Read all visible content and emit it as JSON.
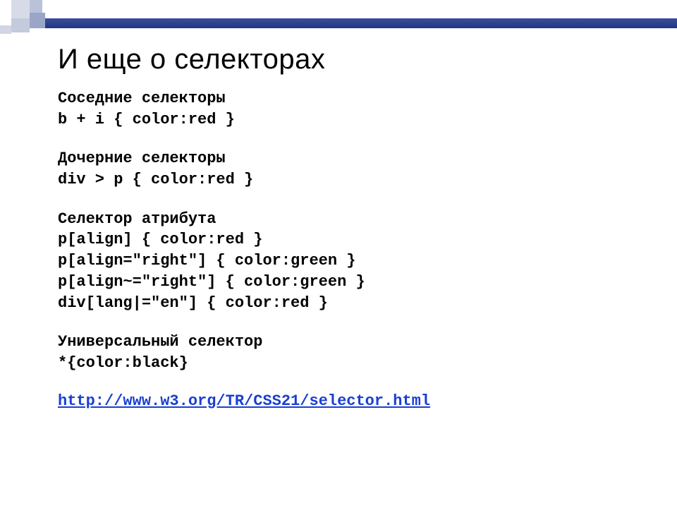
{
  "title": "И еще о селекторах",
  "sections": [
    {
      "heading": "Соседние селекторы",
      "lines": [
        "b + i { color:red }"
      ]
    },
    {
      "heading": "Дочерние селекторы",
      "lines": [
        "div > p { color:red }"
      ]
    },
    {
      "heading": "Селектор атрибута",
      "lines": [
        "p[align] { color:red }",
        "p[align=\"right\"] { color:green }",
        "p[align~=\"right\"] { color:green }",
        "div[lang|=\"en\"] { color:red }"
      ]
    },
    {
      "heading": "Универсальный селектор",
      "lines": [
        "*{color:black}"
      ]
    }
  ],
  "link": "http://www.w3.org/TR/CSS21/selector.html"
}
